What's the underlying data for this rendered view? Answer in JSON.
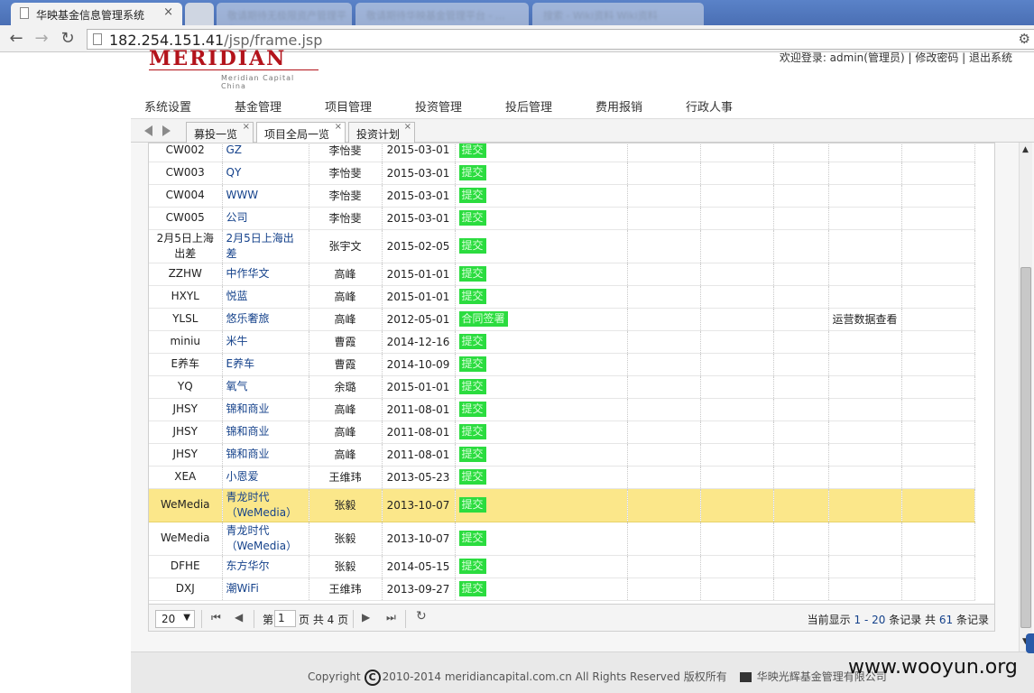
{
  "browser": {
    "tabs": [
      {
        "title": "华映基金信息管理系统",
        "active": true
      },
      {
        "title": "敬请期待无极限资产管理平台 - ...",
        "active": false
      },
      {
        "title": "敬请期待华映基金管理平台 - ...",
        "active": false
      },
      {
        "title": "搜索 - Wiki资料 Wiki资料",
        "active": false
      }
    ],
    "close_glyph": "×",
    "url_host": "182.254.151.41",
    "url_path": "/jsp/frame.jsp"
  },
  "header": {
    "logo_text": "MERIDIAN",
    "logo_sub": "Meridian Capital China",
    "userbar": "欢迎登录: admin(管理员) | 修改密码 | 退出系统"
  },
  "main_nav": [
    "系统设置",
    "基金管理",
    "项目管理",
    "投资管理",
    "投后管理",
    "费用报销",
    "行政人事"
  ],
  "inner_tabs": [
    {
      "label": "募投一览",
      "active": false
    },
    {
      "label": "项目全局一览",
      "active": true
    },
    {
      "label": "投资计划",
      "active": false
    }
  ],
  "grid": {
    "rows": [
      {
        "code": "CW002",
        "name": "GZ",
        "person": "李怡斐",
        "date": "2015-03-01",
        "status": "提交",
        "extra": "",
        "tall": false,
        "selected": false
      },
      {
        "code": "CW003",
        "name": "QY",
        "person": "李怡斐",
        "date": "2015-03-01",
        "status": "提交",
        "extra": "",
        "tall": false,
        "selected": false
      },
      {
        "code": "CW004",
        "name": "WWW",
        "person": "李怡斐",
        "date": "2015-03-01",
        "status": "提交",
        "extra": "",
        "tall": false,
        "selected": false
      },
      {
        "code": "CW005",
        "name": "公司",
        "person": "李怡斐",
        "date": "2015-03-01",
        "status": "提交",
        "extra": "",
        "tall": false,
        "selected": false
      },
      {
        "code": "2月5日上海出差",
        "name": "2月5日上海出差",
        "person": "张宇文",
        "date": "2015-02-05",
        "status": "提交",
        "extra": "",
        "tall": true,
        "selected": false
      },
      {
        "code": "ZZHW",
        "name": "中作华文",
        "person": "高峰",
        "date": "2015-01-01",
        "status": "提交",
        "extra": "",
        "tall": false,
        "selected": false
      },
      {
        "code": "HXYL",
        "name": "悦蓝",
        "person": "高峰",
        "date": "2015-01-01",
        "status": "提交",
        "extra": "",
        "tall": false,
        "selected": false
      },
      {
        "code": "YLSL",
        "name": "悠乐奢旅",
        "person": "高峰",
        "date": "2012-05-01",
        "status": "合同签署",
        "extra": "运营数据查看",
        "tall": false,
        "selected": false
      },
      {
        "code": "miniu",
        "name": "米牛",
        "person": "曹霞",
        "date": "2014-12-16",
        "status": "提交",
        "extra": "",
        "tall": false,
        "selected": false
      },
      {
        "code": "E养车",
        "name": "E养车",
        "person": "曹霞",
        "date": "2014-10-09",
        "status": "提交",
        "extra": "",
        "tall": false,
        "selected": false
      },
      {
        "code": "YQ",
        "name": "氧气",
        "person": "余璐",
        "date": "2015-01-01",
        "status": "提交",
        "extra": "",
        "tall": false,
        "selected": false
      },
      {
        "code": "JHSY",
        "name": "锦和商业",
        "person": "高峰",
        "date": "2011-08-01",
        "status": "提交",
        "extra": "",
        "tall": false,
        "selected": false
      },
      {
        "code": "JHSY",
        "name": "锦和商业",
        "person": "高峰",
        "date": "2011-08-01",
        "status": "提交",
        "extra": "",
        "tall": false,
        "selected": false
      },
      {
        "code": "JHSY",
        "name": "锦和商业",
        "person": "高峰",
        "date": "2011-08-01",
        "status": "提交",
        "extra": "",
        "tall": false,
        "selected": false
      },
      {
        "code": "XEA",
        "name": "小恩爱",
        "person": "王维玮",
        "date": "2013-05-23",
        "status": "提交",
        "extra": "",
        "tall": false,
        "selected": false
      },
      {
        "code": "WeMedia",
        "name": "青龙时代（WeMedia）",
        "person": "张毅",
        "date": "2013-10-07",
        "status": "提交",
        "extra": "",
        "tall": true,
        "selected": true
      },
      {
        "code": "WeMedia",
        "name": "青龙时代（WeMedia）",
        "person": "张毅",
        "date": "2013-10-07",
        "status": "提交",
        "extra": "",
        "tall": true,
        "selected": false
      },
      {
        "code": "DFHE",
        "name": "东方华尔",
        "person": "张毅",
        "date": "2014-05-15",
        "status": "提交",
        "extra": "",
        "tall": false,
        "selected": false
      },
      {
        "code": "DXJ",
        "name": "潮WiFi",
        "person": "王维玮",
        "date": "2013-09-27",
        "status": "提交",
        "extra": "",
        "tall": false,
        "selected": false
      }
    ]
  },
  "pager": {
    "page_size": "20",
    "page_prefix": "第",
    "current_page": "1",
    "page_suffix": "页 共 4 页",
    "info_prefix": "当前显示",
    "info_range": "1 - 20",
    "info_mid": "条记录 共",
    "info_total": "61",
    "info_suffix": "条记录"
  },
  "footer": {
    "copyright_label": "Copyright",
    "copyright_symbol": "C",
    "copyright_text": "2010-2014 meridiancapital.com.cn All Rights Reserved 版权所有",
    "company": "华映光辉基金管理有限公司"
  },
  "watermark": "www.wooyun.org"
}
